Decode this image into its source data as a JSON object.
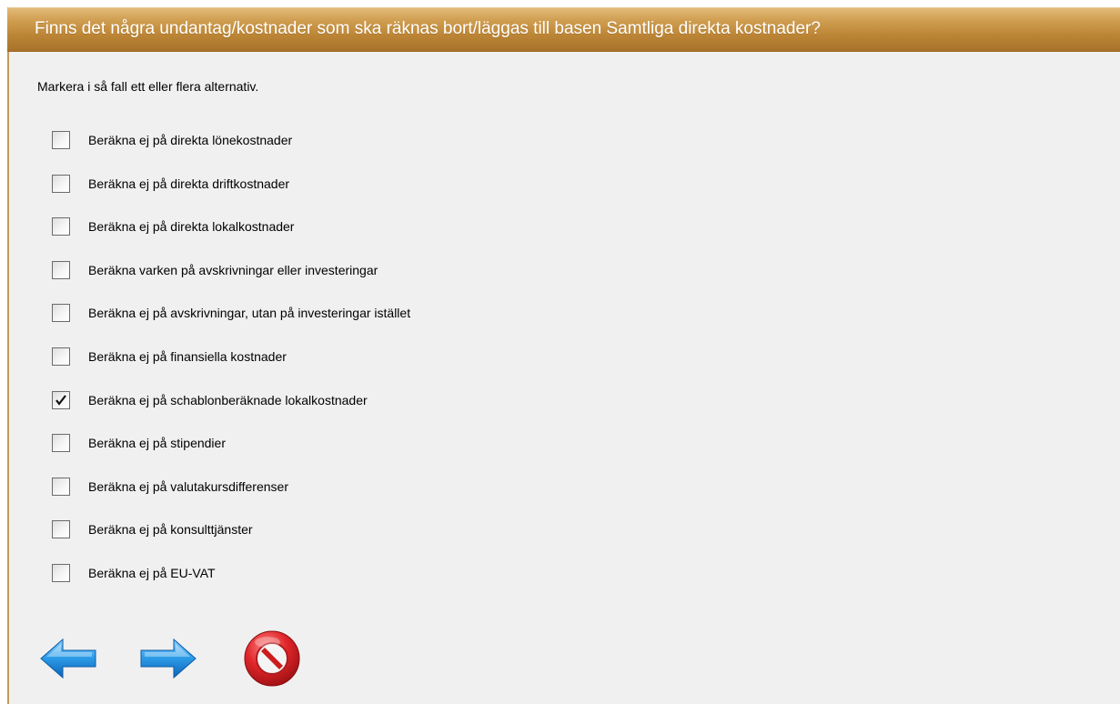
{
  "dialog": {
    "title": "Finns det några undantag/kostnader som ska räknas bort/läggas till basen Samtliga direkta kostnader?",
    "instruction": "Markera i så fall ett eller flera alternativ."
  },
  "options": [
    {
      "label": "Beräkna ej på direkta lönekostnader",
      "checked": false
    },
    {
      "label": "Beräkna ej på direkta driftkostnader",
      "checked": false
    },
    {
      "label": "Beräkna ej på direkta lokalkostnader",
      "checked": false
    },
    {
      "label": "Beräkna varken på avskrivningar eller investeringar",
      "checked": false
    },
    {
      "label": "Beräkna ej på avskrivningar, utan på investeringar istället",
      "checked": false
    },
    {
      "label": "Beräkna ej på finansiella kostnader",
      "checked": false
    },
    {
      "label": "Beräkna ej på schablonberäknade lokalkostnader",
      "checked": true
    },
    {
      "label": "Beräkna ej på stipendier",
      "checked": false
    },
    {
      "label": "Beräkna ej på valutakursdifferenser",
      "checked": false
    },
    {
      "label": "Beräkna ej på konsulttjänster",
      "checked": false
    },
    {
      "label": "Beräkna ej på EU-VAT",
      "checked": false
    }
  ],
  "navigation": {
    "back_icon": "arrow-left-icon",
    "forward_icon": "arrow-right-icon",
    "cancel_icon": "cancel-icon"
  },
  "colors": {
    "title_bar": "#bb8435",
    "title_text": "#ffffff",
    "background": "#f0f0f0",
    "arrow_blue": "#1f8fe0",
    "cancel_red": "#cc1c1c"
  }
}
